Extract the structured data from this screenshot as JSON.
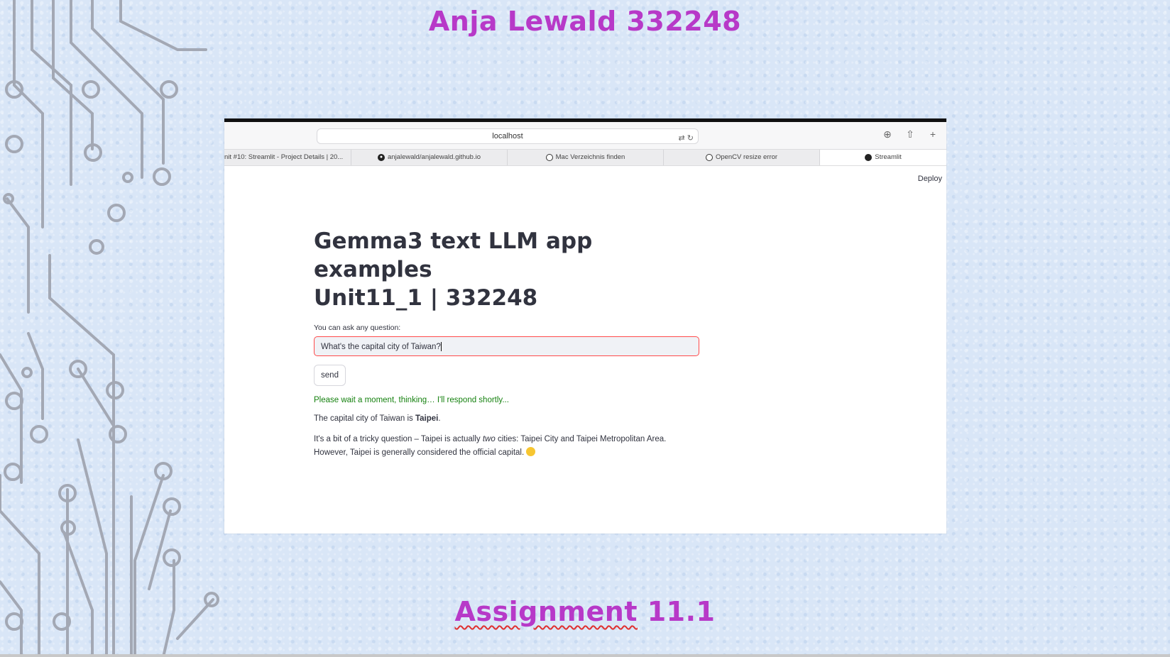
{
  "slide": {
    "title": "Anja Lewald 332248",
    "subtitle_word1": "Assignment",
    "subtitle_word2": "11.1"
  },
  "browser": {
    "url": "localhost",
    "tabs": [
      {
        "label": "nit #10: Streamlit - Project Details | 20...",
        "icon": "none"
      },
      {
        "label": "anjalewald/anjalewald.github.io",
        "icon": "github-icon"
      },
      {
        "label": "Mac Verzeichnis finden",
        "icon": "openai-icon"
      },
      {
        "label": "OpenCV resize error",
        "icon": "openai-icon"
      },
      {
        "label": "Streamlit",
        "icon": "streamlit-icon"
      }
    ],
    "toolbar_icons": [
      "download-icon",
      "share-icon",
      "new-tab-icon"
    ]
  },
  "app": {
    "deploy_label": "Deploy",
    "title_line1": "Gemma3 text LLM app examples",
    "title_line2": "Unit11_1 | 332248",
    "input_label": "You can ask any question:",
    "input_value": "What's the capital city of Taiwan?",
    "send_label": "send",
    "status_text": "Please wait a moment, thinking… I'll respond shortly...",
    "answer_prefix": "The capital city of Taiwan is ",
    "answer_bold": "Taipei",
    "answer_suffix": ".",
    "detail_part1": "It's a bit of a tricky question – Taipei is actually ",
    "detail_italic": "two",
    "detail_part2": " cities: Taipei City and Taipei Metropolitan Area.",
    "detail_line2": "However, Taipei is generally considered the official capital."
  },
  "colors": {
    "slide_title": "#b739c8",
    "input_border": "#ff4b4b",
    "status_green": "#15810f",
    "background": "#d9e6f7"
  }
}
